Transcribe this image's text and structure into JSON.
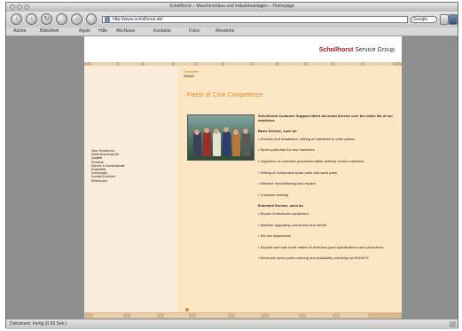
{
  "window": {
    "title": "Schollhorst – Maschinenbau und Industrieanlagen – Homepage"
  },
  "toolbar": {
    "back_label": "‹",
    "forward_label": "›",
    "reload_label": "↻",
    "home_label": "⌂",
    "url": "http://www.schollhorst.de/",
    "search_label": "Google"
  },
  "bookmarks": {
    "items": [
      "Adobe",
      "Bibliothek",
      "Apple",
      "Hilfe",
      "AbcNews",
      "Kontakte",
      "Fotos",
      "Abnahme"
    ]
  },
  "site": {
    "logo_brand": "Schollhorst",
    "logo_suffix": "Service Group"
  },
  "crumbs": [
    "Startseite",
    "Aktuell"
  ],
  "left_nav": [
    "Über Schollhorst",
    "Unternehmensprofil",
    "Qualität",
    "Produkte",
    "Service & Kundendienst",
    "Ersatzteile",
    "Schulungen",
    "Kontakt & Anfahrt",
    "Referenzen"
  ],
  "main": {
    "heading": "Fields of Core Competence",
    "intro_bold": "Schollhorst Customer Support offers all-round Service over the entire life of our machines.",
    "basic_heading": "Basic Service, such as:",
    "basic_items": [
      "• Erection and installation, setting of machines to other places",
      "• Spare parts lists for new machines",
      "• Inspection of customer processes within delivery of new machines",
      "• Setting of component spare parts and wear parts",
      "• Machine reconditioning and repairs",
      "• Customer training"
    ],
    "extended_heading": "Extended Service, such as:",
    "extended_items": [
      "• Repair of electronic equipment",
      "• Machine upgrading conversion and retrofit",
      "• Service inspections",
      "• Support and sale in the matter of technical good specifications and procedures",
      "• Electronic spare parts ordering and availability checking via EDI/DFÜ"
    ]
  },
  "status": {
    "text": "Dokument: Fertig (0.93 Sek.)"
  }
}
